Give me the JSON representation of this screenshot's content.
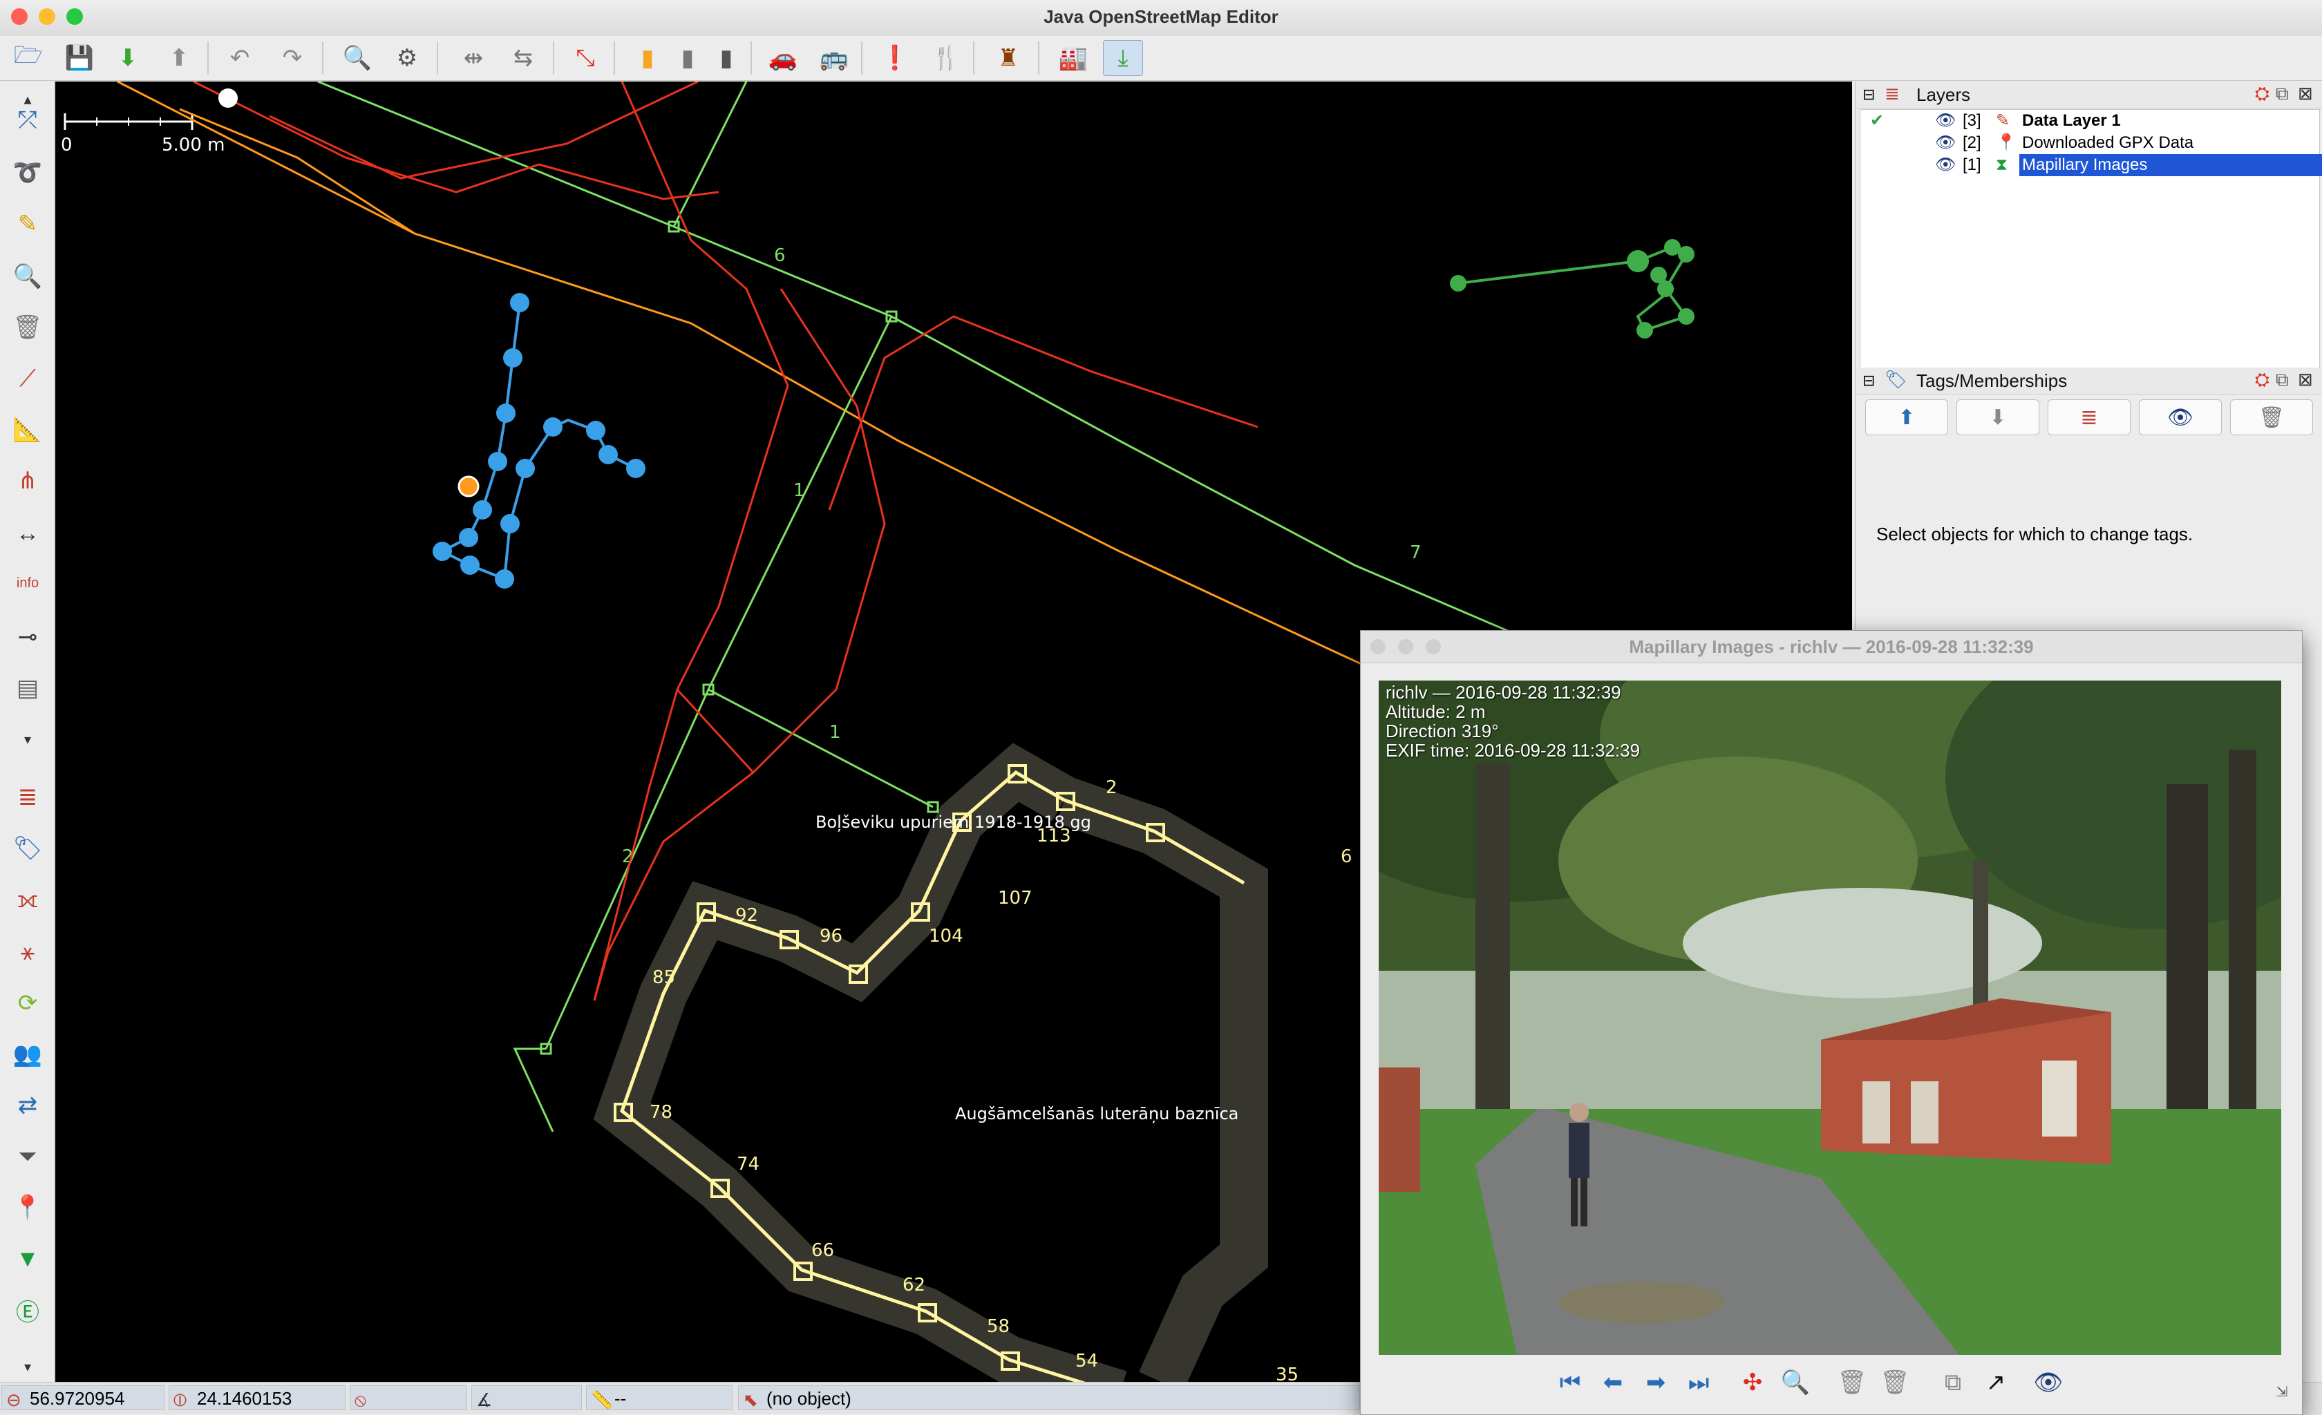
{
  "window": {
    "title": "Java OpenStreetMap Editor"
  },
  "map": {
    "scale_zero": "0",
    "scale_label": "5.00 m",
    "labels": {
      "memorial": "Boļševiku upuriem 1918-1918 gg",
      "church": "Augšāmcelšanās luterāņu baznīca"
    },
    "green_numbers": [
      "6",
      "7",
      "1",
      "1",
      "2"
    ],
    "node_numbers": [
      "2",
      "113",
      "6",
      "107",
      "104",
      "96",
      "92",
      "85",
      "78",
      "74",
      "66",
      "62",
      "58",
      "54",
      "35"
    ]
  },
  "layers_panel": {
    "title": "Layers",
    "layers": [
      {
        "index": "[3]",
        "name": "Data Layer 1",
        "active": true
      },
      {
        "index": "[2]",
        "name": "Downloaded GPX Data",
        "active": false
      },
      {
        "index": "[1]",
        "name": "Mapillary Images",
        "active": false
      }
    ]
  },
  "tags_panel": {
    "title": "Tags/Memberships",
    "empty_message": "Select objects for which to change tags."
  },
  "image_viewer": {
    "title": "Mapillary Images - richlv — 2016-09-28 11:32:39",
    "overlay": {
      "user_time": "richlv — 2016-09-28 11:32:39",
      "altitude": "Altitude: 2 m",
      "direction": "Direction 319°",
      "exif": "EXIF time: 2016-09-28 11:32:39"
    }
  },
  "status_bar": {
    "lat": "56.9720954",
    "lon": "24.1460153",
    "distance": "--",
    "object": "(no object)"
  },
  "colors": {
    "selection": "#1e56d6",
    "gpx_track": "#e8321e",
    "osm_way_orange": "#ff9a1c",
    "green_way": "#7ee063",
    "mapillary_blue": "#3aa0e8",
    "building": "#fff5a0"
  }
}
